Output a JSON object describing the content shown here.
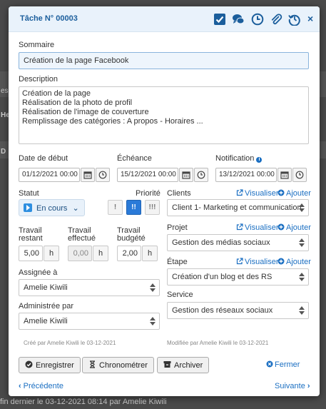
{
  "background": {
    "footer_text": "fin dernier le 03-12-2021 08:14 par Amelie Kiwili",
    "fragments": [
      "es",
      "He",
      "D"
    ]
  },
  "modal": {
    "title": "Tâche N° 00003",
    "header_icons": [
      "check-square-icon",
      "comments-icon",
      "clock-icon",
      "paperclip-icon",
      "history-icon"
    ],
    "close_label": "×"
  },
  "sommaire": {
    "label": "Sommaire",
    "value": "Création de la page Facebook"
  },
  "description": {
    "label": "Description",
    "lines": [
      "Création de la page",
      "Réalisation de la photo de profil",
      "Réalisation de l'image de couverture",
      "Remplissage des catégories : A propos - Horaires ..."
    ]
  },
  "dates": {
    "debut": {
      "label": "Date de début",
      "value": "01/12/2021 00:00"
    },
    "echeance": {
      "label": "Échéance",
      "value": "15/12/2021 00:00"
    },
    "notification": {
      "label": "Notification",
      "value": "13/12/2021 00:00"
    }
  },
  "statut": {
    "label": "Statut",
    "value": "En cours",
    "caret": "⌄"
  },
  "priorite": {
    "label": "Priorité",
    "options": [
      "!",
      "!!",
      "!!!"
    ],
    "selected": "!!"
  },
  "travail": {
    "restant": {
      "label_1": "Travail",
      "label_2": "restant",
      "value": "5,00",
      "unit": "h"
    },
    "effectue": {
      "label_1": "Travail",
      "label_2": "effectué",
      "value": "0,00",
      "unit": "h"
    },
    "budgete": {
      "label_1": "Travail",
      "label_2": "budgété",
      "value": "2,00",
      "unit": "h"
    }
  },
  "assignee": {
    "label": "Assignée à",
    "value": "Amelie Kiwili"
  },
  "administree": {
    "label": "Administrée par",
    "value": "Amelie Kiwili"
  },
  "clients": {
    "label": "Clients",
    "value": "Client 1- Marketing et communication",
    "link_view": "Visualiser",
    "link_add": "Ajouter"
  },
  "projet": {
    "label": "Projet",
    "value": "Gestion des médias sociaux",
    "link_view": "Visualiser",
    "link_add": "Ajouter"
  },
  "etape": {
    "label": "Étape",
    "value": "Création d'un blog et des RS",
    "link_view": "Visualiser",
    "link_add": "Ajouter"
  },
  "service": {
    "label": "Service",
    "value": "Gestion des réseaux sociaux"
  },
  "meta": {
    "created": "Créé par Amelie Kiwili le 03-12-2021",
    "modified": "Modifiée par Amelie Kiwili le 03-12-2021"
  },
  "actions": {
    "save": "Enregistrer",
    "timer": "Chronométrer",
    "archive": "Archiver",
    "close": "Fermer"
  },
  "nav": {
    "prev": "Précédente",
    "next": "Suivante",
    "prev_glyph": "‹",
    "next_glyph": "›"
  },
  "colors": {
    "accent": "#1b6fc2",
    "title": "#1b5e9c",
    "priority_active": "#2a7ad8"
  }
}
